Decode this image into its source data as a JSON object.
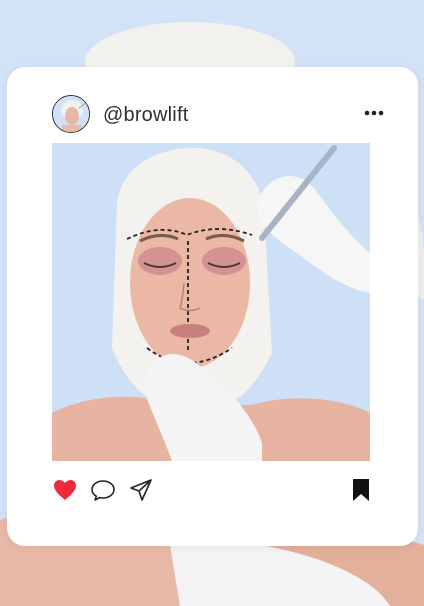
{
  "post": {
    "username": "@browlift",
    "liked": true,
    "saved": true
  },
  "icons": {
    "more": "more-dots-icon",
    "like": "heart-icon",
    "comment": "comment-bubble-icon",
    "share": "send-paper-plane-icon",
    "save": "bookmark-icon"
  },
  "colors": {
    "background": "#d3e2f6",
    "card": "#ffffff",
    "like_red": "#f0293c",
    "icon_dark": "#222222"
  }
}
